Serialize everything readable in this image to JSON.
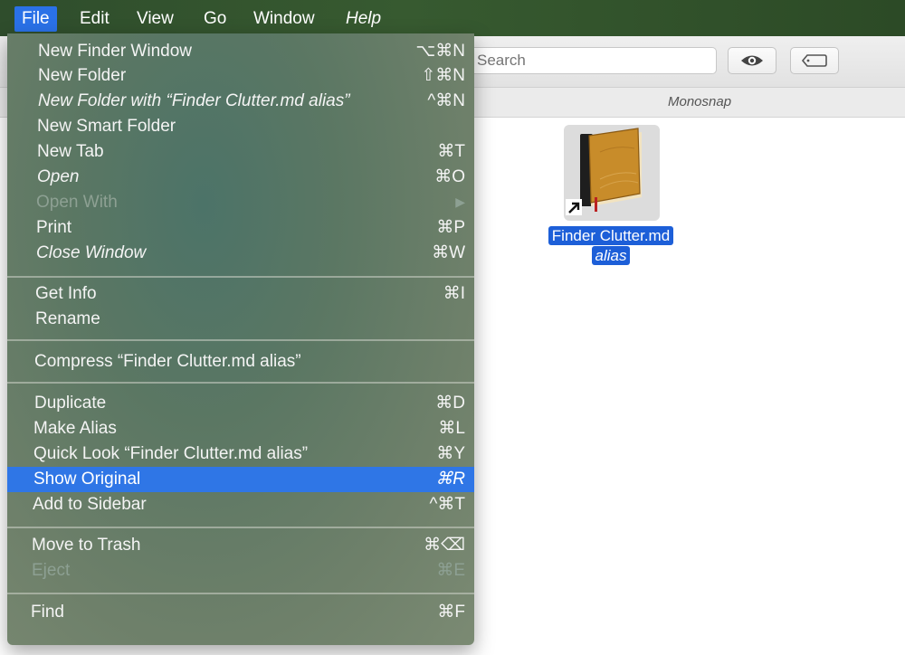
{
  "menubar": {
    "items": [
      {
        "label": "File"
      },
      {
        "label": "Edit"
      },
      {
        "label": "View"
      },
      {
        "label": "Go"
      },
      {
        "label": "Window"
      },
      {
        "label": "Help"
      }
    ],
    "active_color": "#2a71e7"
  },
  "finder": {
    "search": {
      "placeholder": "Search"
    },
    "tab_label": "Monosnap",
    "quicklook_icon": "eye-icon",
    "tag_icon": "tag-icon",
    "file": {
      "name_line1": "Finder Clutter.md",
      "name_line2": "alias",
      "icon": "book-alias-icon"
    }
  },
  "file_menu": {
    "highlight_color": "#2f76e6",
    "items": [
      {
        "label": "New Finder Window",
        "shortcut": "⌥⌘N"
      },
      {
        "label": "New Folder",
        "shortcut": "⇧⌘N"
      },
      {
        "label": "New Folder with “Finder Clutter.md alias”",
        "shortcut": "^⌘N"
      },
      {
        "label": "New Smart Folder",
        "shortcut": ""
      },
      {
        "label": "New Tab",
        "shortcut": "⌘T"
      },
      {
        "label": "Open",
        "shortcut": "⌘O"
      },
      {
        "label": "Open With",
        "shortcut": "▶"
      },
      {
        "label": "Print",
        "shortcut": "⌘P"
      },
      {
        "label": "Close Window",
        "shortcut": "⌘W"
      },
      {
        "label": "Get Info",
        "shortcut": "⌘I"
      },
      {
        "label": "Rename",
        "shortcut": ""
      },
      {
        "label": "Compress “Finder Clutter.md alias”",
        "shortcut": ""
      },
      {
        "label": "Duplicate",
        "shortcut": "⌘D"
      },
      {
        "label": "Make Alias",
        "shortcut": "⌘L"
      },
      {
        "label": "Quick Look “Finder Clutter.md alias”",
        "shortcut": "⌘Y"
      },
      {
        "label": "Show Original",
        "shortcut": "⌘R"
      },
      {
        "label": "Add to Sidebar",
        "shortcut": "^⌘T"
      },
      {
        "label": "Move to Trash",
        "shortcut": "⌘⌫"
      },
      {
        "label": "Eject",
        "shortcut": "⌘E"
      },
      {
        "label": "Find",
        "shortcut": "⌘F"
      }
    ]
  }
}
